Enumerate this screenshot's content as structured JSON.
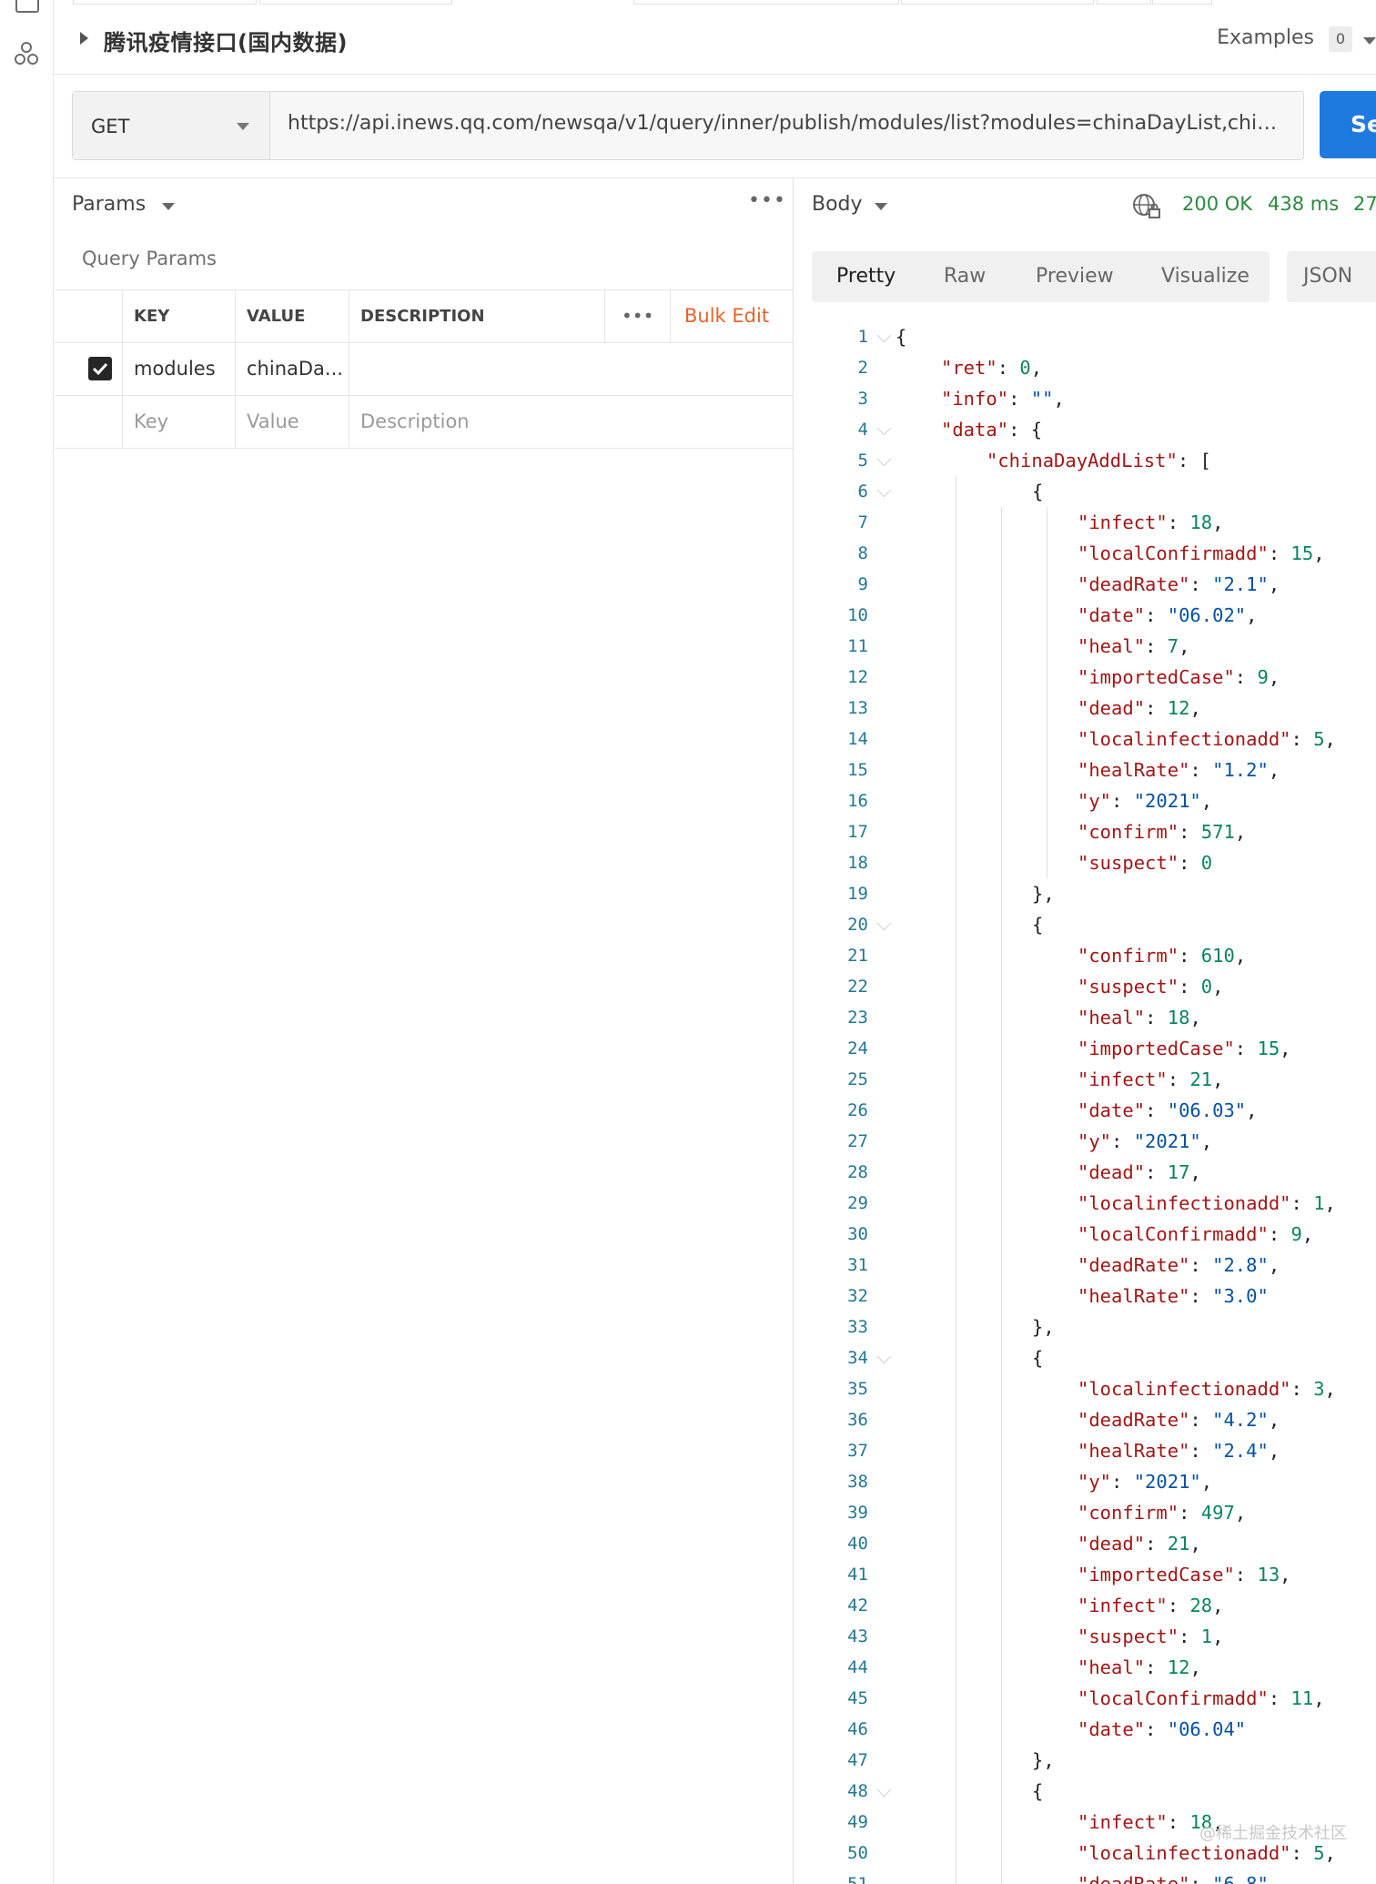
{
  "request": {
    "title": "腾讯疫情接口(国内数据)",
    "examples_label": "Examples",
    "examples_count": "0",
    "method": "GET",
    "url": "https://api.inews.qq.com/newsqa/v1/query/inner/publish/modules/list?modules=chinaDayList,chinaDayAddList,nowConfirmStatis,provinceCompare",
    "send_label": "Se"
  },
  "params": {
    "tab_label": "Params",
    "section_title": "Query Params",
    "columns": {
      "key": "KEY",
      "value": "VALUE",
      "description": "DESCRIPTION"
    },
    "bulk_edit": "Bulk Edit",
    "rows": [
      {
        "checked": true,
        "key": "modules",
        "value": "chinaDa...",
        "description": ""
      }
    ],
    "placeholders": {
      "key": "Key",
      "value": "Value",
      "description": "Description"
    }
  },
  "response": {
    "tab_label": "Body",
    "status": "200 OK",
    "time": "438 ms",
    "size": "27",
    "view_tabs": [
      "Pretty",
      "Raw",
      "Preview",
      "Visualize"
    ],
    "active_view": "Pretty",
    "format": "JSON",
    "lines": [
      [
        "{",
        ""
      ],
      [
        "  \"ret\": 0,",
        ""
      ],
      [
        "  \"info\": \"\",",
        ""
      ],
      [
        "  \"data\": {",
        ""
      ],
      [
        "    \"chinaDayAddList\": [",
        ""
      ],
      [
        "      {",
        ""
      ],
      [
        "        \"infect\": 18,",
        ""
      ],
      [
        "        \"localConfirmadd\": 15,",
        ""
      ],
      [
        "        \"deadRate\": \"2.1\",",
        ""
      ],
      [
        "        \"date\": \"06.02\",",
        ""
      ],
      [
        "        \"heal\": 7,",
        ""
      ],
      [
        "        \"importedCase\": 9,",
        ""
      ],
      [
        "        \"dead\": 12,",
        ""
      ],
      [
        "        \"localinfectionadd\": 5,",
        ""
      ],
      [
        "        \"healRate\": \"1.2\",",
        ""
      ],
      [
        "        \"y\": \"2021\",",
        ""
      ],
      [
        "        \"confirm\": 571,",
        ""
      ],
      [
        "        \"suspect\": 0",
        ""
      ],
      [
        "      },",
        ""
      ],
      [
        "      {",
        ""
      ],
      [
        "        \"confirm\": 610,",
        ""
      ],
      [
        "        \"suspect\": 0,",
        ""
      ],
      [
        "        \"heal\": 18,",
        ""
      ],
      [
        "        \"importedCase\": 15,",
        ""
      ],
      [
        "        \"infect\": 21,",
        ""
      ],
      [
        "        \"date\": \"06.03\",",
        ""
      ],
      [
        "        \"y\": \"2021\",",
        ""
      ],
      [
        "        \"dead\": 17,",
        ""
      ],
      [
        "        \"localinfectionadd\": 1,",
        ""
      ],
      [
        "        \"localConfirmadd\": 9,",
        ""
      ],
      [
        "        \"deadRate\": \"2.8\",",
        ""
      ],
      [
        "        \"healRate\": \"3.0\"",
        ""
      ],
      [
        "      },",
        ""
      ],
      [
        "      {",
        ""
      ],
      [
        "        \"localinfectionadd\": 3,",
        ""
      ],
      [
        "        \"deadRate\": \"4.2\",",
        ""
      ],
      [
        "        \"healRate\": \"2.4\",",
        ""
      ],
      [
        "        \"y\": \"2021\",",
        ""
      ],
      [
        "        \"confirm\": 497,",
        ""
      ],
      [
        "        \"dead\": 21,",
        ""
      ],
      [
        "        \"importedCase\": 13,",
        ""
      ],
      [
        "        \"infect\": 28,",
        ""
      ],
      [
        "        \"suspect\": 1,",
        ""
      ],
      [
        "        \"heal\": 12,",
        ""
      ],
      [
        "        \"localConfirmadd\": 11,",
        ""
      ],
      [
        "        \"date\": \"06.04\"",
        ""
      ],
      [
        "      },",
        ""
      ],
      [
        "      {",
        ""
      ],
      [
        "        \"infect\": 18,",
        ""
      ],
      [
        "        \"localinfectionadd\": 5,",
        ""
      ],
      [
        "        \"deadRate\": \"6.8\",",
        ""
      ]
    ]
  },
  "watermark": "@稀土掘金技术社区",
  "colors": {
    "key": "#a31515",
    "number": "#098658",
    "string": "#0451a5",
    "link": "#e8622a",
    "send": "#1f7ae0",
    "ok": "#2b8a3e"
  }
}
